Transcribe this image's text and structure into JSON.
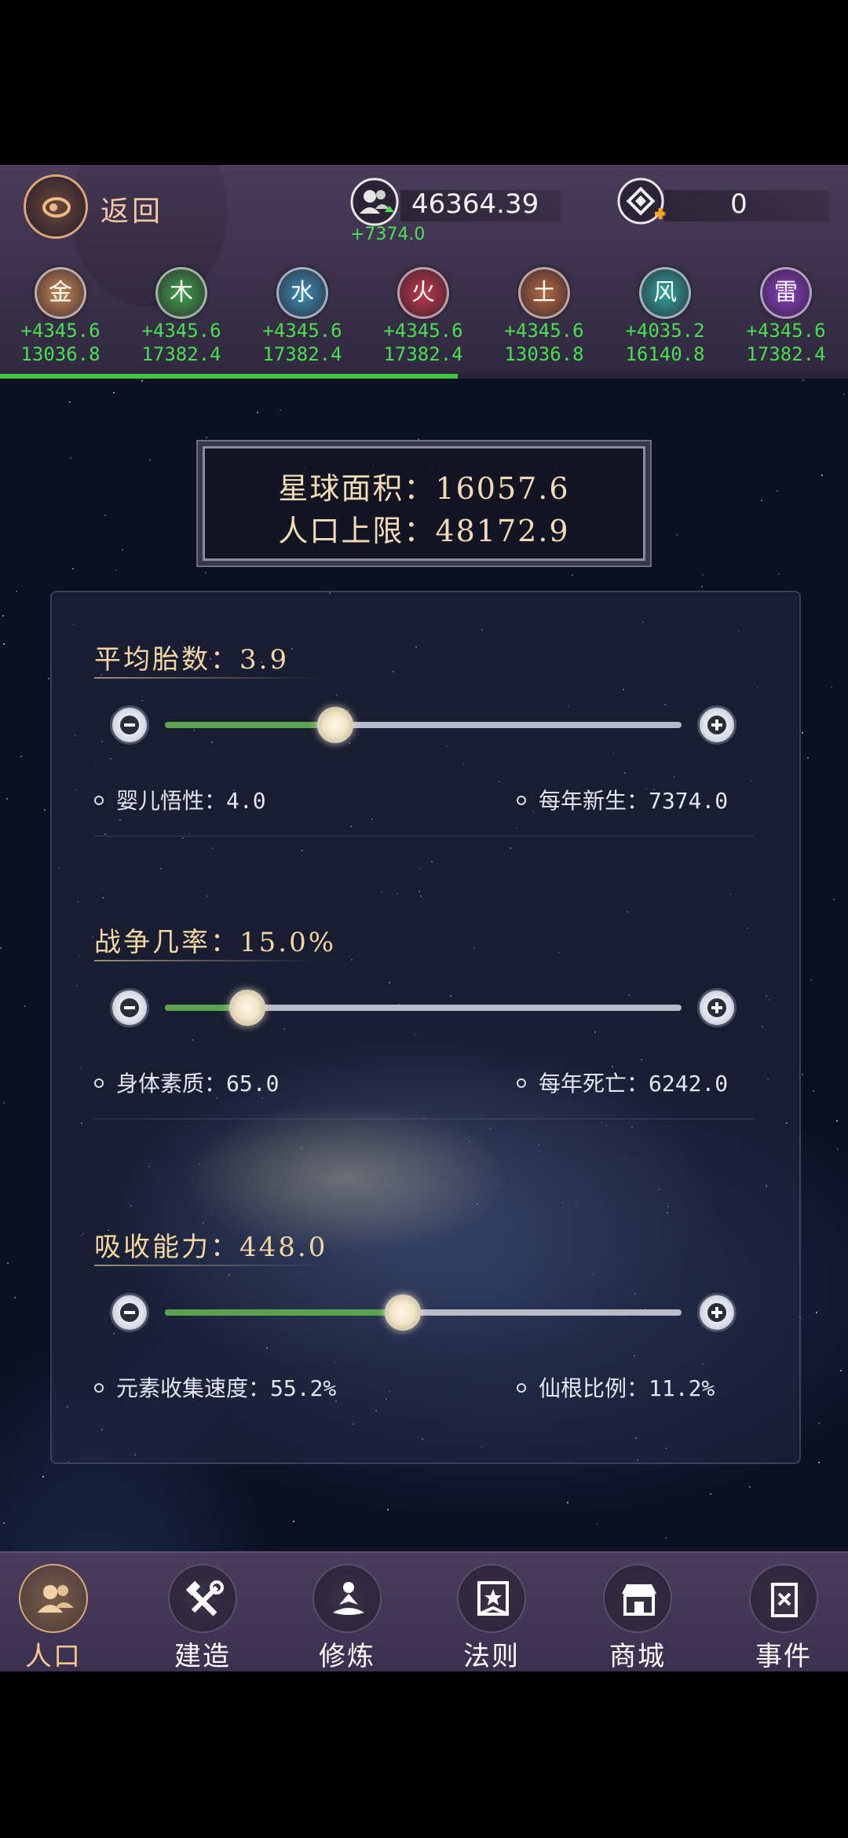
{
  "header": {
    "back_label": "返回",
    "population_value": "46364.39",
    "population_delta": "+7374.0",
    "gem_value": "0",
    "elements": [
      {
        "name": "金",
        "rate": "+4345.6",
        "total": "13036.8",
        "color": "#c98a52"
      },
      {
        "name": "木",
        "rate": "+4345.6",
        "total": "17382.4",
        "color": "#3fa24a"
      },
      {
        "name": "水",
        "rate": "+4345.6",
        "total": "17382.4",
        "color": "#3b8fb8"
      },
      {
        "name": "火",
        "rate": "+4345.6",
        "total": "17382.4",
        "color": "#c2384a"
      },
      {
        "name": "土",
        "rate": "+4345.6",
        "total": "13036.8",
        "color": "#b66a40"
      },
      {
        "name": "风",
        "rate": "+4035.2",
        "total": "16140.8",
        "color": "#2fa8a0"
      },
      {
        "name": "雷",
        "rate": "+4345.6",
        "total": "17382.4",
        "color": "#8a3fc4"
      }
    ],
    "progress_fraction": 0.54
  },
  "plaque": {
    "line1": "星球面积：16057.6",
    "line2": "人口上限：48172.9"
  },
  "sections": [
    {
      "title": "平均胎数：3.9",
      "slider_fraction": 0.33,
      "left_stat": "婴儿悟性：4.0",
      "right_stat": "每年新生：7374.0"
    },
    {
      "title": "战争几率：15.0%",
      "slider_fraction": 0.16,
      "left_stat": "身体素质：65.0",
      "right_stat": "每年死亡：6242.0"
    },
    {
      "title": "吸收能力：448.0",
      "slider_fraction": 0.46,
      "left_stat": "元素收集速度：55.2%",
      "right_stat": "仙根比例：11.2%"
    }
  ],
  "nav": {
    "items": [
      {
        "label": "人口",
        "icon": "people-icon",
        "active": true
      },
      {
        "label": "建造",
        "icon": "tools-icon",
        "active": false
      },
      {
        "label": "修炼",
        "icon": "meditation-icon",
        "active": false
      },
      {
        "label": "法则",
        "icon": "banner-icon",
        "active": false
      },
      {
        "label": "商城",
        "icon": "shop-icon",
        "active": false
      },
      {
        "label": "事件",
        "icon": "book-icon",
        "active": false
      }
    ]
  }
}
